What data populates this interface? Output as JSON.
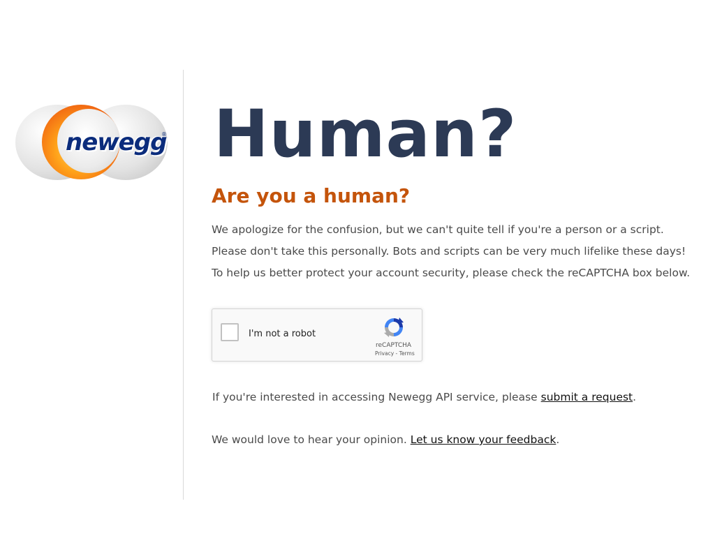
{
  "logo": {
    "brand": "newegg",
    "registered_mark": "®",
    "colors": {
      "orange": "#f26a12",
      "navy": "#0b2c7c",
      "silver": "#d6d6d6"
    }
  },
  "main": {
    "title": "Human?",
    "subtitle": "Are you a human?",
    "messages": [
      "We apologize for the confusion, but we can't quite tell if you're a person or a script.",
      "Please don't take this personally. Bots and scripts can be very much lifelike these days!",
      "To help us better protect your account security, please check the reCAPTCHA box below."
    ]
  },
  "recaptcha": {
    "checkbox_label": "I'm not a robot",
    "brand": "reCAPTCHA",
    "privacy": "Privacy",
    "separator": " - ",
    "terms": "Terms",
    "icon": "recaptcha-logo-icon"
  },
  "api": {
    "prefix": "If you're interested in accessing Newegg API service, please ",
    "link": "submit a request",
    "suffix": "."
  },
  "feedback": {
    "prefix": "We would love to hear your opinion. ",
    "link": "Let us know your feedback",
    "suffix": "."
  },
  "colors": {
    "title": "#2c3a55",
    "subtitle": "#c4540b",
    "body_text": "#4a4a4a"
  }
}
